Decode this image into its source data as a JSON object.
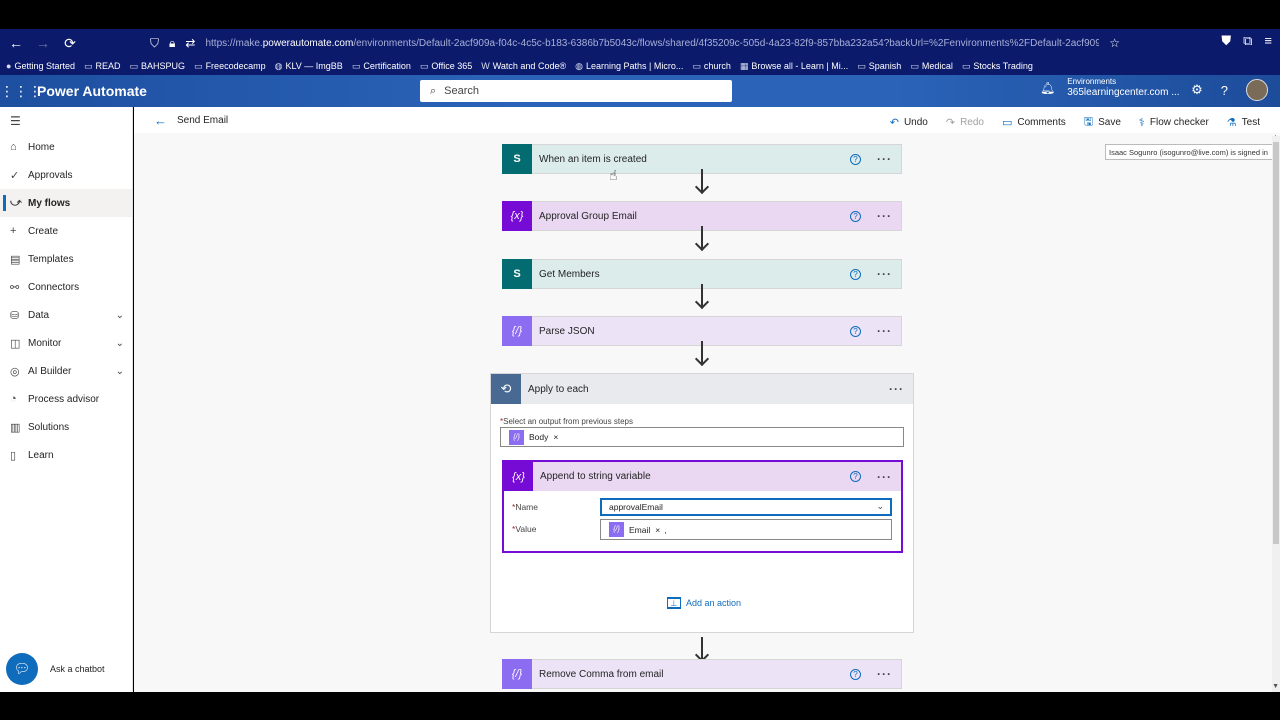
{
  "browser": {
    "url_host_prefix": "https://make.",
    "url_host": "powerautomate.com",
    "url_path": "/environments/Default-2acf909a-f04c-4c5c-b183-6386b7b5043c/flows/shared/4f35209c-505d-4a23-82f9-857bba232a54?backUrl=%2Fenvironments%2FDefault-2acf909a-f04c-4c5c",
    "bookmarks": [
      {
        "label": "Getting Started",
        "icon": "firefox-icon"
      },
      {
        "label": "READ",
        "icon": "folder-icon"
      },
      {
        "label": "BAHSPUG",
        "icon": "folder-icon"
      },
      {
        "label": "Freecodecamp",
        "icon": "folder-icon"
      },
      {
        "label": "KLV — ImgBB",
        "icon": "globe-icon"
      },
      {
        "label": "Certification",
        "icon": "folder-icon"
      },
      {
        "label": "Office 365",
        "icon": "folder-icon"
      },
      {
        "label": "Watch and Code®",
        "icon": "w-icon"
      },
      {
        "label": "Learning Paths | Micro...",
        "icon": "globe-icon"
      },
      {
        "label": "church",
        "icon": "folder-icon"
      },
      {
        "label": "Browse all - Learn | Mi...",
        "icon": "microsoft-icon"
      },
      {
        "label": "Spanish",
        "icon": "folder-icon"
      },
      {
        "label": "Medical",
        "icon": "folder-icon"
      },
      {
        "label": "Stocks Trading",
        "icon": "folder-icon"
      }
    ]
  },
  "header": {
    "app_title": "Power Automate",
    "search_placeholder": "Search",
    "env_label": "Environments",
    "env_value": "365learningcenter.com ..."
  },
  "sidebar": {
    "items": [
      {
        "label": "Home",
        "icon": "home-icon",
        "active": false
      },
      {
        "label": "Approvals",
        "icon": "approvals-icon",
        "active": false
      },
      {
        "label": "My flows",
        "icon": "flows-icon",
        "active": true
      },
      {
        "label": "Create",
        "icon": "plus-icon",
        "active": false
      },
      {
        "label": "Templates",
        "icon": "templates-icon",
        "active": false
      },
      {
        "label": "Connectors",
        "icon": "connectors-icon",
        "active": false
      },
      {
        "label": "Data",
        "icon": "data-icon",
        "active": false,
        "expandable": true
      },
      {
        "label": "Monitor",
        "icon": "monitor-icon",
        "active": false,
        "expandable": true
      },
      {
        "label": "AI Builder",
        "icon": "ai-builder-icon",
        "active": false,
        "expandable": true
      },
      {
        "label": "Process advisor",
        "icon": "process-advisor-icon",
        "active": false
      },
      {
        "label": "Solutions",
        "icon": "solutions-icon",
        "active": false
      },
      {
        "label": "Learn",
        "icon": "learn-icon",
        "active": false
      }
    ],
    "chatbot_label": "Ask a chatbot"
  },
  "commandbar": {
    "flow_name": "Send Email",
    "undo": "Undo",
    "redo": "Redo",
    "comments": "Comments",
    "save": "Save",
    "flow_checker": "Flow checker",
    "test": "Test"
  },
  "tooltip": "Isaac Sogunro (isogunro@live.com) is signed in",
  "flow": {
    "steps": [
      {
        "title": "When an item is created",
        "kind": "sp",
        "icon_text": "S"
      },
      {
        "title": "Approval Group Email",
        "kind": "var",
        "icon_text": "{x}"
      },
      {
        "title": "Get Members",
        "kind": "sp",
        "icon_text": "S"
      },
      {
        "title": "Parse JSON",
        "kind": "dop",
        "icon_text": "{/}"
      }
    ],
    "loop": {
      "title": "Apply to each",
      "select_label": "Select an output from previous steps",
      "token": "Body",
      "inner": {
        "title": "Append to string variable",
        "name_label": "Name",
        "name_value": "approvalEmail",
        "value_label": "Value",
        "value_token": "Email",
        "value_suffix": ","
      },
      "add_action": "Add an action"
    },
    "last_step": {
      "title": "Remove Comma from email",
      "kind": "dop",
      "icon_text": "{/}"
    }
  },
  "colors": {
    "accent": "#0f6cbd",
    "sharepoint": "#036c70",
    "variable": "#770bd6",
    "data_operation": "#8c6cf0",
    "loop": "#486991"
  }
}
